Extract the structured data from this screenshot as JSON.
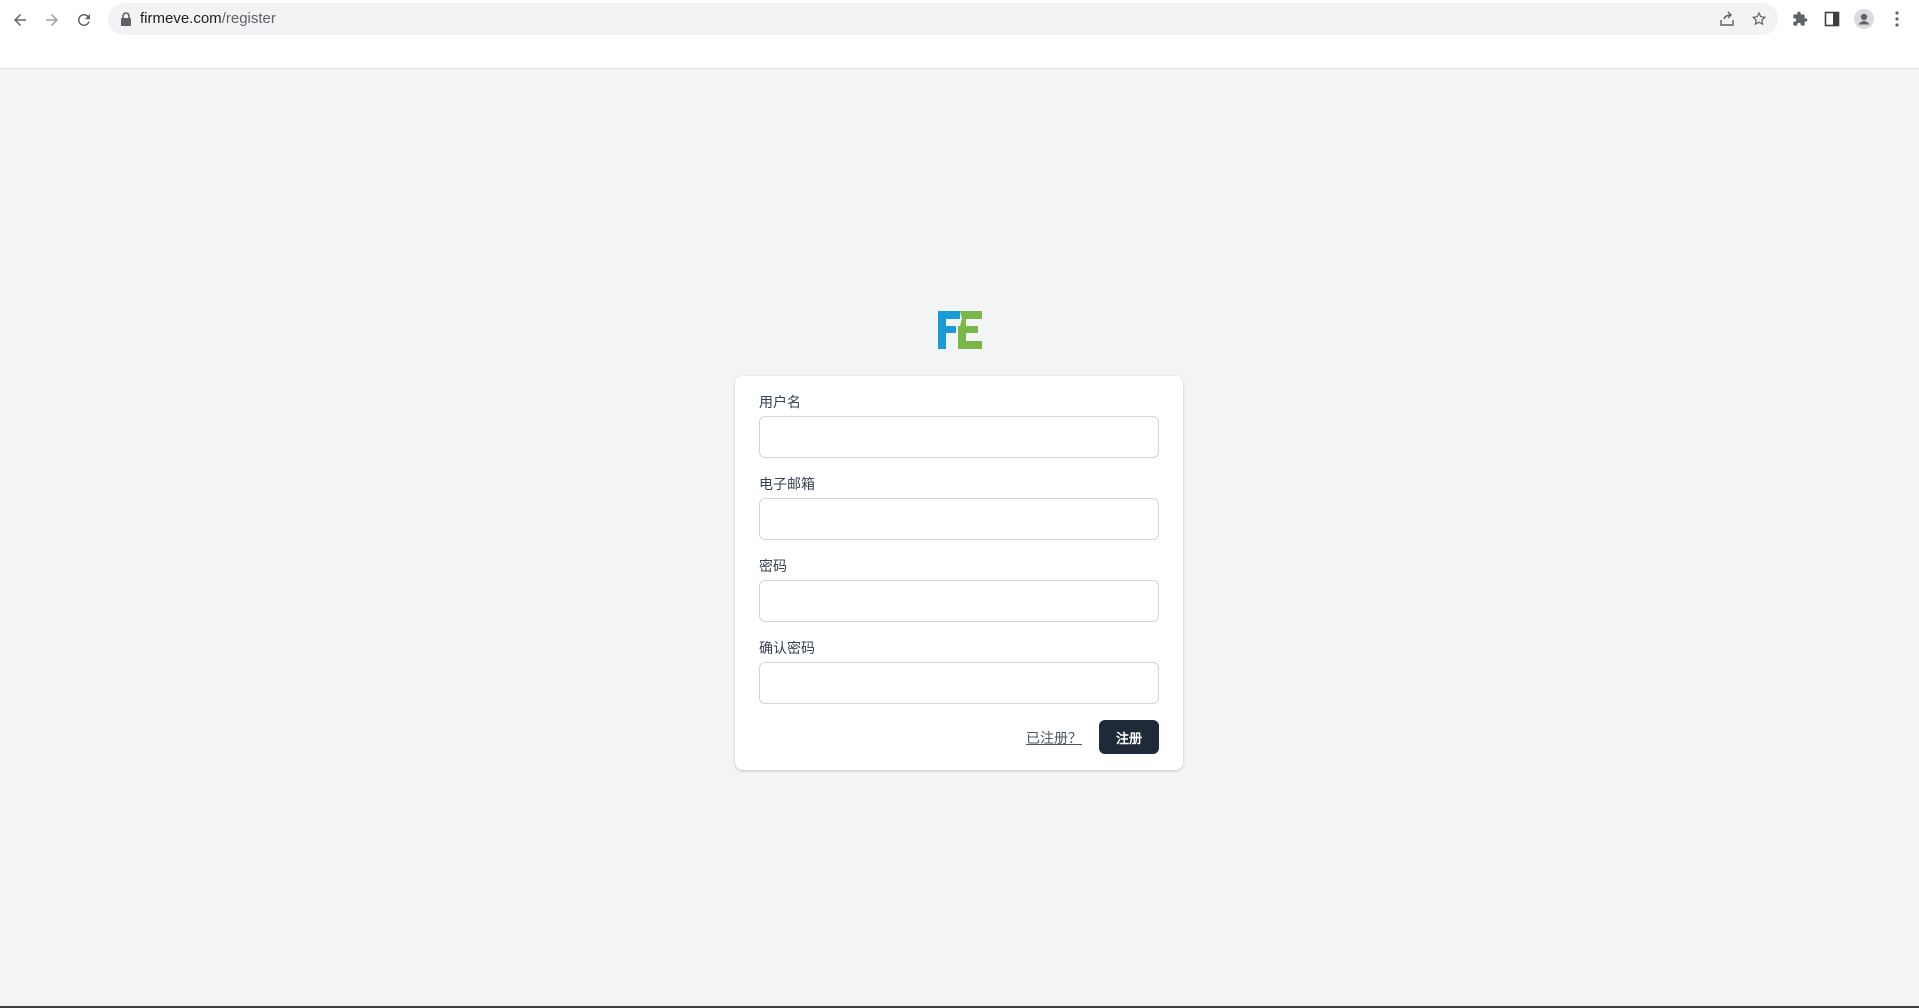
{
  "browser": {
    "url_host": "firmeve.com",
    "url_path": "/register",
    "icons": {
      "back": "arrow-left-icon",
      "forward": "arrow-right-icon",
      "reload": "reload-icon",
      "lock": "lock-icon",
      "share": "share-icon",
      "bookmark": "star-icon",
      "extensions": "puzzle-icon",
      "side_panel": "side-panel-icon",
      "profile": "profile-icon",
      "menu": "kebab-menu-icon"
    }
  },
  "logo": {
    "text": "FE",
    "colors": {
      "f": "#1a9ad6",
      "e": "#7ab648"
    }
  },
  "form": {
    "username_label": "用户名",
    "username_value": "",
    "email_label": "电子邮箱",
    "email_value": "",
    "password_label": "密码",
    "password_value": "",
    "confirm_label": "确认密码",
    "confirm_value": "",
    "login_link": "已注册？",
    "register_button": "注册"
  },
  "colors": {
    "page_bg": "#f3f4f6",
    "button_bg": "#1f2937",
    "input_border": "#d1d5db"
  }
}
